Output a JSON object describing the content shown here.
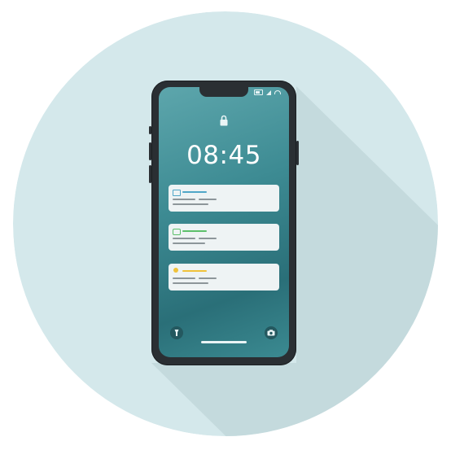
{
  "lockscreen": {
    "time": "08:45"
  },
  "icons": {
    "lock": "padlock-icon",
    "flashlight": "flashlight-icon",
    "camera": "camera-icon",
    "battery": "battery-icon",
    "signal": "signal-icon",
    "wifi": "wifi-icon"
  },
  "notifications": [
    {
      "accent": "#4fa6c8",
      "icon": "message-icon"
    },
    {
      "accent": "#5cc06b",
      "icon": "chat-icon"
    },
    {
      "accent": "#f0c23a",
      "icon": "contact-icon"
    }
  ],
  "colors": {
    "background_circle": "#d4e8eb",
    "shadow": "#c0d6d9",
    "phone_body": "#2a2f33",
    "screen_top": "#5da6ac",
    "screen_bottom": "#2a6f78",
    "card": "#eef3f4",
    "card_text_bar": "#8d969a"
  }
}
